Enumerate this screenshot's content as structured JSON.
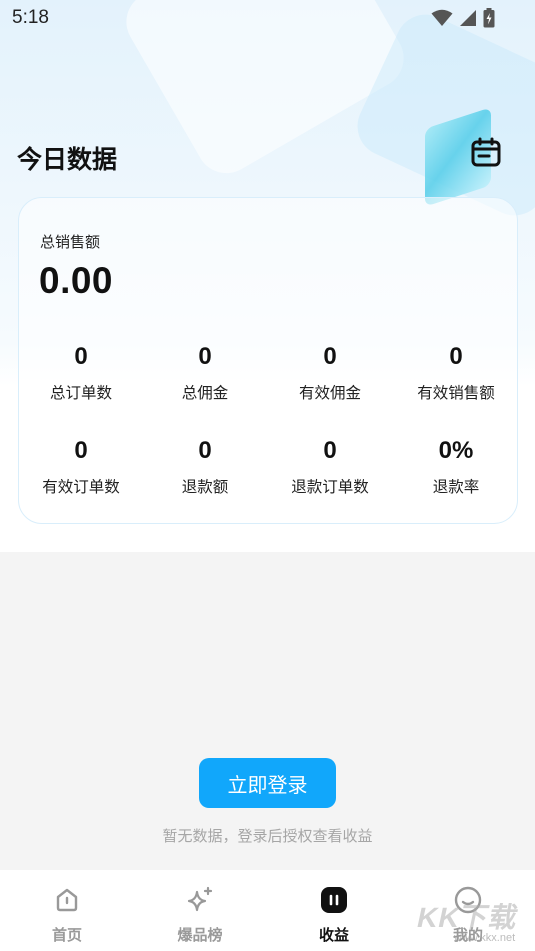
{
  "status_bar": {
    "time": "5:18",
    "icons": [
      "wifi-icon",
      "signal-icon",
      "battery-icon"
    ]
  },
  "header": {
    "title": "今日数据",
    "calendar_icon": "calendar-icon"
  },
  "stats": {
    "total_sales_label": "总销售额",
    "total_sales_value": "0.00",
    "metrics": [
      {
        "value": "0",
        "label": "总订单数"
      },
      {
        "value": "0",
        "label": "总佣金"
      },
      {
        "value": "0",
        "label": "有效佣金"
      },
      {
        "value": "0",
        "label": "有效销售额"
      },
      {
        "value": "0",
        "label": "有效订单数"
      },
      {
        "value": "0",
        "label": "退款额"
      },
      {
        "value": "0",
        "label": "退款订单数"
      },
      {
        "value": "0%",
        "label": "退款率"
      }
    ]
  },
  "empty_state": {
    "button_label": "立即登录",
    "hint": "暂无数据，登录后授权查看收益"
  },
  "tabbar": {
    "tabs": [
      {
        "label": "首页",
        "icon": "home-icon",
        "active": false
      },
      {
        "label": "爆品榜",
        "icon": "sparkle-icon",
        "active": false
      },
      {
        "label": "收益",
        "icon": "earnings-icon",
        "active": true
      },
      {
        "label": "我的",
        "icon": "profile-icon",
        "active": false
      }
    ]
  },
  "watermark": {
    "text": "KK下载",
    "url": "www.kkx.net"
  },
  "colors": {
    "accent": "#11a7fb",
    "card_border": "#d9eefb",
    "hint_text": "#a6a6a6",
    "page_bg": "#f4f4f4"
  }
}
